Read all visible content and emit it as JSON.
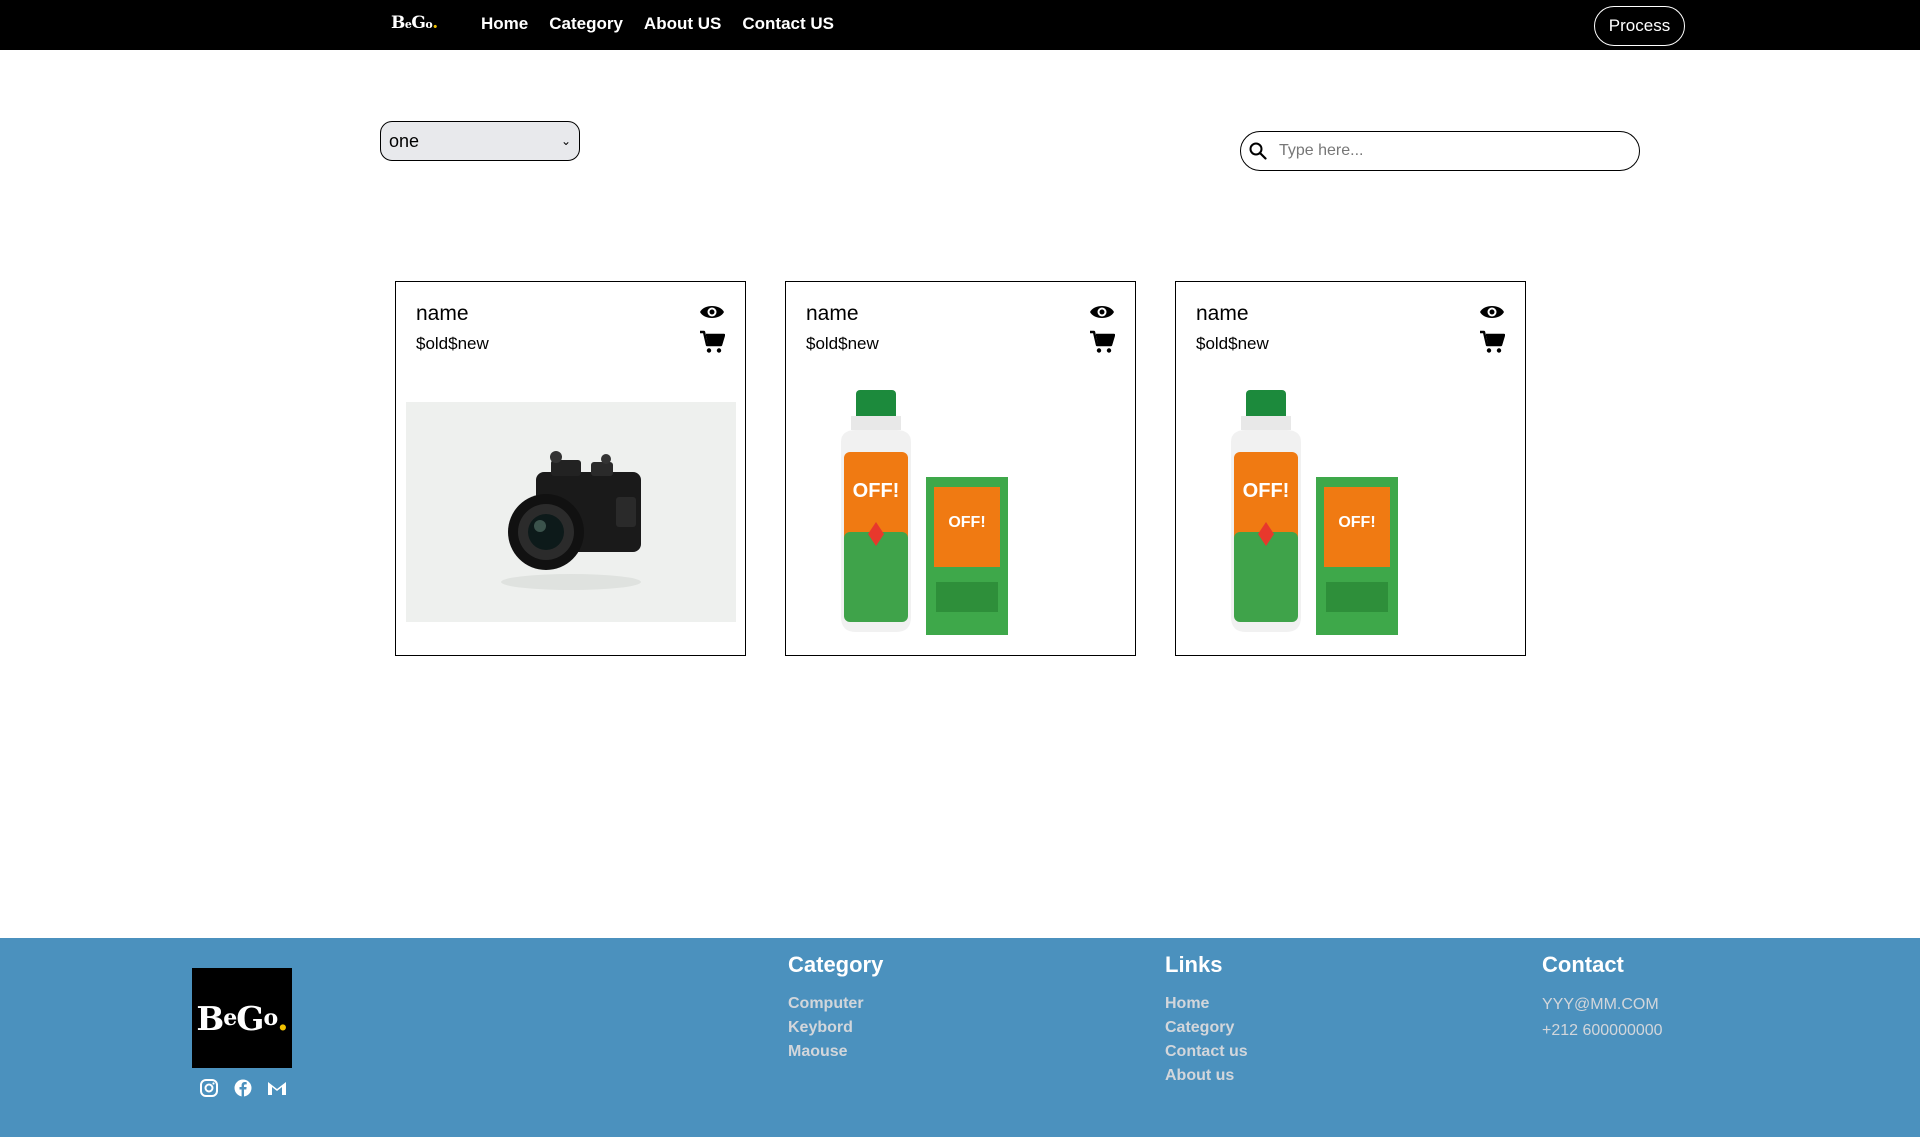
{
  "navbar": {
    "logo": {
      "b": "B",
      "e": "e",
      "g": "G",
      "o": "o",
      "dot": "."
    },
    "links": [
      "Home",
      "Category",
      "About US",
      "Contact US"
    ],
    "process_label": "Process"
  },
  "filter": {
    "selected": "one"
  },
  "search": {
    "placeholder": "Type here..."
  },
  "cards": [
    {
      "name": "name",
      "price": "$old$new",
      "image": "camera"
    },
    {
      "name": "name",
      "price": "$old$new",
      "image": "off-repellent"
    },
    {
      "name": "name",
      "price": "$old$new",
      "image": "off-repellent"
    }
  ],
  "footer": {
    "logo": {
      "b": "B",
      "e": "e",
      "g": "G",
      "o": "o",
      "dot": "."
    },
    "social_icons": [
      "instagram-icon",
      "facebook-icon",
      "gmail-icon"
    ],
    "category": {
      "title": "Category",
      "items": [
        "Computer",
        "Keybord",
        "Maouse"
      ]
    },
    "links": {
      "title": "Links",
      "items": [
        "Home",
        "Category",
        "Contact us",
        "About us"
      ]
    },
    "contact": {
      "title": "Contact",
      "email": "YYY@MM.COM",
      "phone": "+212 600000000"
    }
  },
  "colors": {
    "navbar": "#000000",
    "footer": "#4b91be",
    "logo_dot": "#f2c200"
  }
}
